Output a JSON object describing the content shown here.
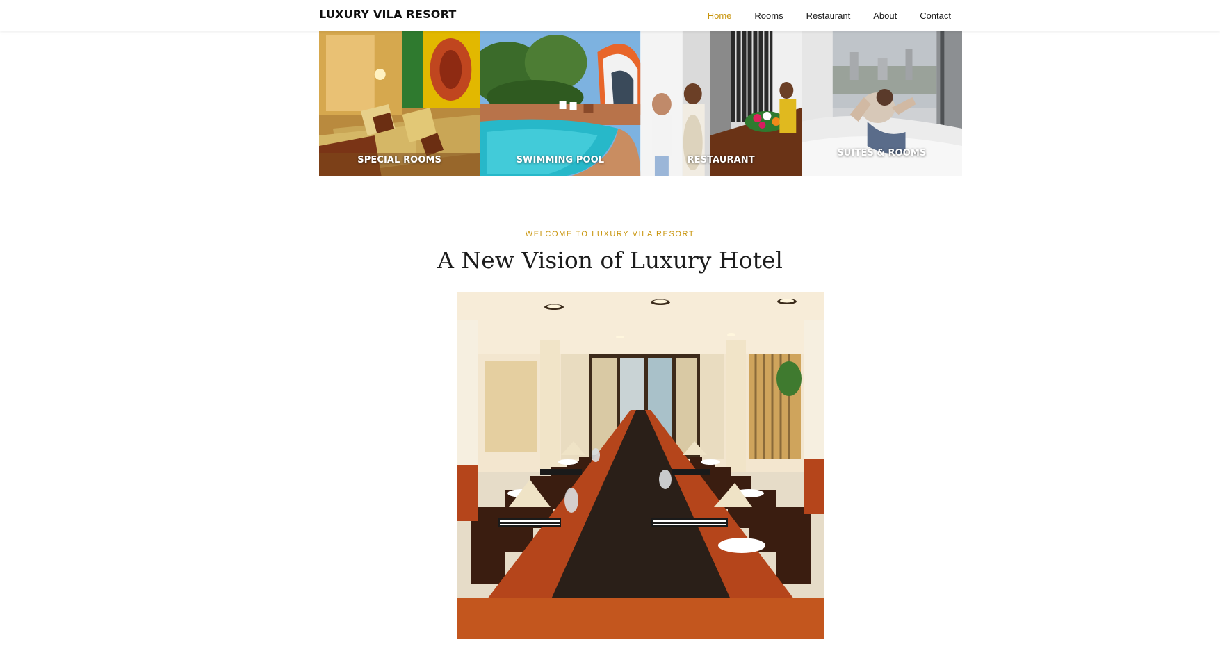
{
  "header": {
    "brand": "LUXURY VILA RESORT",
    "nav": [
      "Home",
      "Rooms",
      "Restaurant",
      "About",
      "Contact"
    ],
    "active_nav": "Home",
    "accent_color": "#c8940b"
  },
  "tiles": [
    {
      "label": "SPECIAL ROOMS"
    },
    {
      "label": "SWIMMING POOL"
    },
    {
      "label": "RESTAURANT"
    },
    {
      "label": "SUITES & ROOMS"
    }
  ],
  "welcome": {
    "eyebrow": "WELCOME TO LUXURY VILA RESORT",
    "headline": "A New Vision of Luxury Hotel"
  }
}
